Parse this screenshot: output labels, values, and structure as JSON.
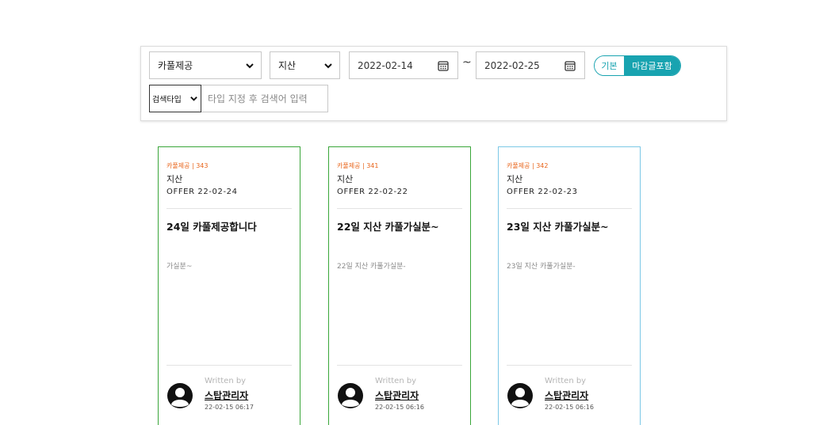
{
  "filters": {
    "category": "카풀제공",
    "region": "지산",
    "date_from": "2022-02-14",
    "date_to": "2022-02-25",
    "tilde": "~",
    "toggle": {
      "basic": "기본",
      "include_closed": "마감글포함"
    },
    "search_type": "검색타입",
    "search_placeholder": "타입 지정 후 검색어 입력"
  },
  "cards": [
    {
      "meta": "카풀제공 | 343",
      "location": "지산",
      "offer": "OFFER 22-02-24",
      "title": "24일 카풀제공합니다",
      "body": "가실분~",
      "written_by": "Written by",
      "author": "스탑관리자",
      "datetime": "22-02-15 06:17"
    },
    {
      "meta": "카풀제공 | 341",
      "location": "지산",
      "offer": "OFFER 22-02-22",
      "title": "22일 지산 카풀가실분~",
      "body": "22일 지산 카풀가실분-",
      "written_by": "Written by",
      "author": "스탑관리자",
      "datetime": "22-02-15 06:16"
    },
    {
      "meta": "카풀제공 | 342",
      "location": "지산",
      "offer": "OFFER 22-02-23",
      "title": "23일 지산 카풀가실분~",
      "body": "23일 지산 카풀가실분-",
      "written_by": "Written by",
      "author": "스탑관리자",
      "datetime": "22-02-15 06:16"
    }
  ],
  "colors": {
    "accent": "#18a3b0",
    "meta_orange": "#e8641a",
    "card_border_green": "#3aa63a",
    "card_border_blue": "#7cc8e6"
  },
  "icons": [
    "chevron-down-icon",
    "calendar-icon",
    "user-avatar-icon"
  ]
}
